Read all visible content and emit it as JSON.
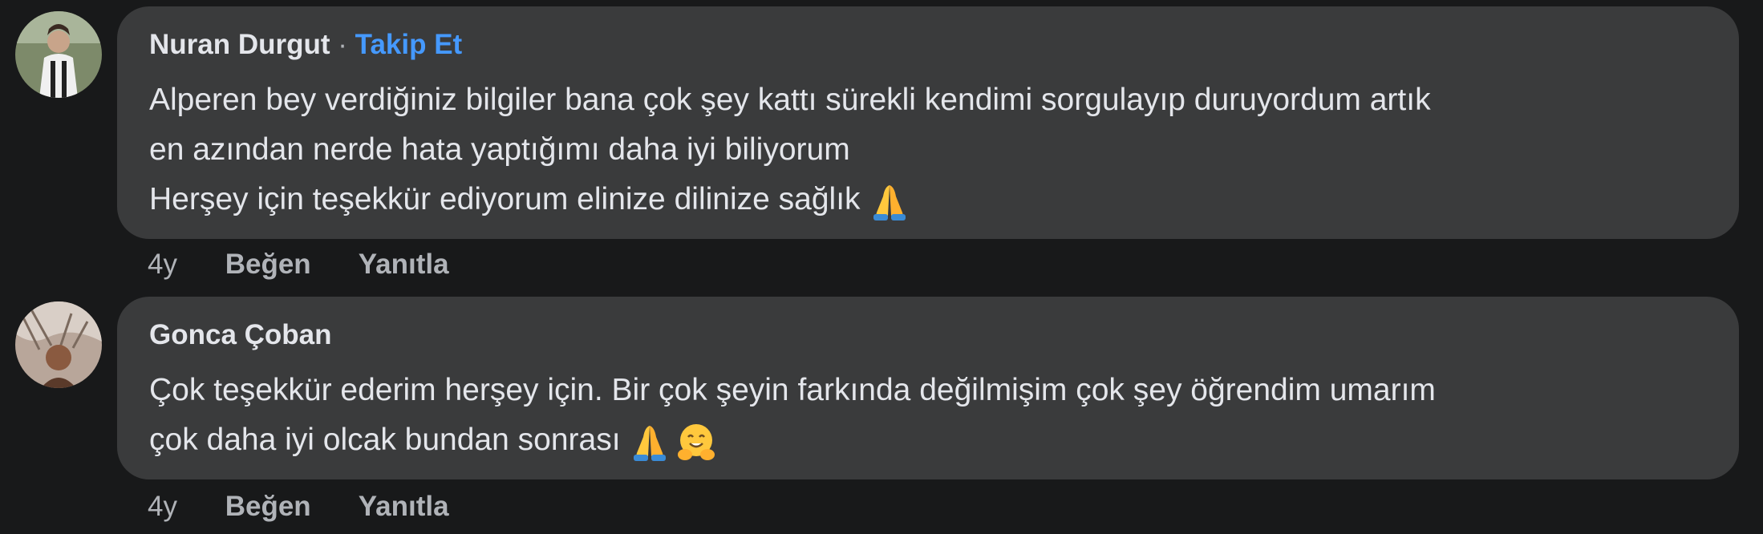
{
  "comments": [
    {
      "author": "Nuran Durgut",
      "separator": "·",
      "follow_label": "Takip Et",
      "lines": [
        "Alperen bey verdiğiniz bilgiler bana çok şey kattı sürekli kendimi sorgulayıp duruyordum artık",
        "en azından nerde hata yaptığımı daha iyi biliyorum",
        "Herşey için teşekkür ediyorum elinize dilinize sağlık"
      ],
      "emojis": [
        "folded-hands"
      ],
      "time": "4y",
      "like_label": "Beğen",
      "reply_label": "Yanıtla"
    },
    {
      "author": "Gonca Çoban",
      "lines": [
        "Çok teşekkür ederim herşey için. Bir çok şeyin farkında değilmişim çok şey öğrendim umarım",
        "çok daha iyi olcak bundan sonrası"
      ],
      "emojis": [
        "folded-hands",
        "hugging-face"
      ],
      "time": "4y",
      "like_label": "Beğen",
      "reply_label": "Yanıtla"
    }
  ],
  "colors": {
    "background": "#18191a",
    "bubble": "#3a3b3c",
    "text": "#e4e6eb",
    "secondary_text": "#b0b3b8",
    "link": "#4599ff"
  }
}
